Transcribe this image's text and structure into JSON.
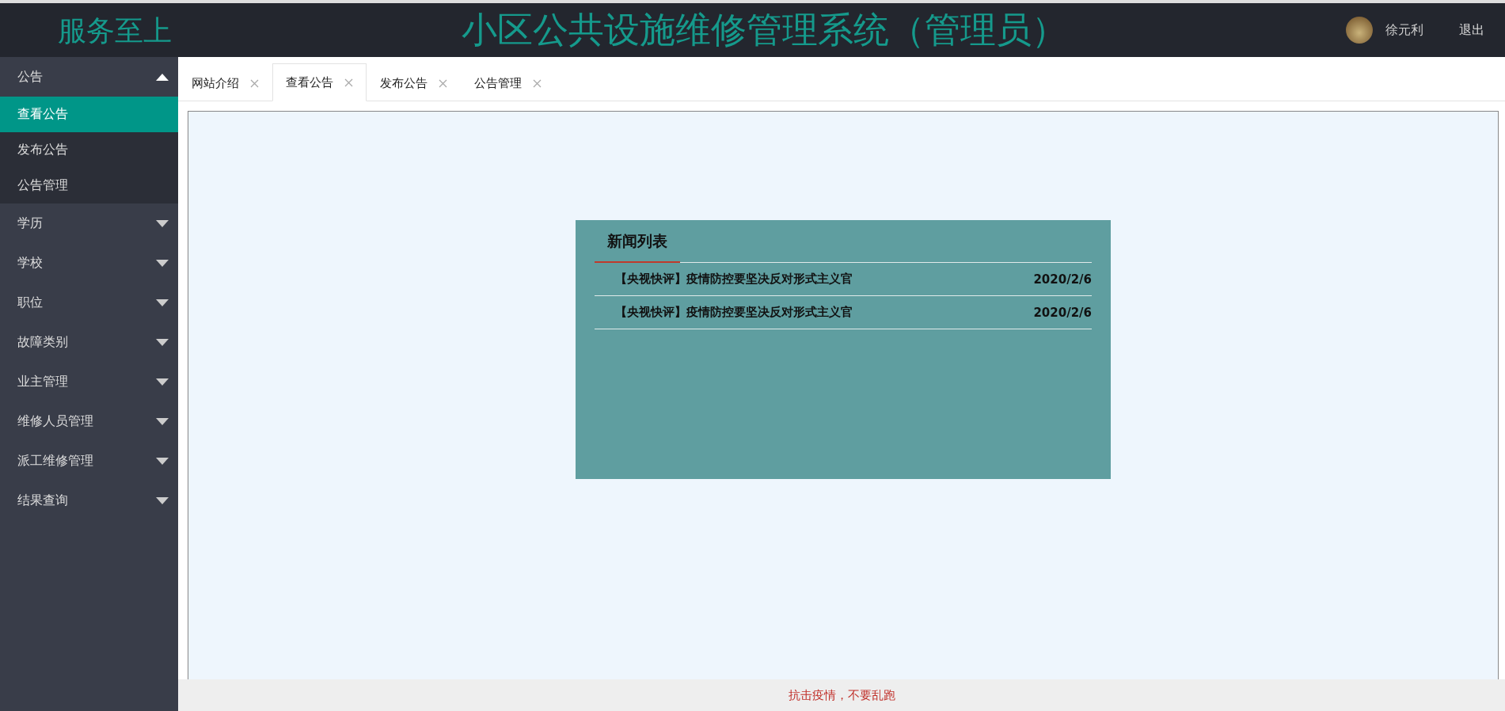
{
  "header": {
    "slogan": "服务至上",
    "title": "小区公共设施维修管理系统（管理员）",
    "user_name": "徐元利",
    "logout": "退出"
  },
  "sidebar": {
    "groups": [
      {
        "label": "公告",
        "expanded": true,
        "children": [
          {
            "label": "查看公告",
            "selected": true
          },
          {
            "label": "发布公告",
            "selected": false
          },
          {
            "label": "公告管理",
            "selected": false
          }
        ]
      },
      {
        "label": "学历",
        "expanded": false
      },
      {
        "label": "学校",
        "expanded": false
      },
      {
        "label": "职位",
        "expanded": false
      },
      {
        "label": "故障类别",
        "expanded": false
      },
      {
        "label": "业主管理",
        "expanded": false
      },
      {
        "label": "维修人员管理",
        "expanded": false
      },
      {
        "label": "派工维修管理",
        "expanded": false
      },
      {
        "label": "结果查询",
        "expanded": false
      }
    ]
  },
  "tabs": [
    {
      "label": "网站介绍",
      "selected": false
    },
    {
      "label": "查看公告",
      "selected": true
    },
    {
      "label": "发布公告",
      "selected": false
    },
    {
      "label": "公告管理",
      "selected": false
    }
  ],
  "news": {
    "title": "新闻列表",
    "items": [
      {
        "title": "【央视快评】疫情防控要坚决反对形式主义官",
        "date": "2020/2/6"
      },
      {
        "title": "【央视快评】疫情防控要坚决反对形式主义官",
        "date": "2020/2/6"
      }
    ]
  },
  "footer": {
    "text": "抗击疫情，不要乱跑"
  }
}
